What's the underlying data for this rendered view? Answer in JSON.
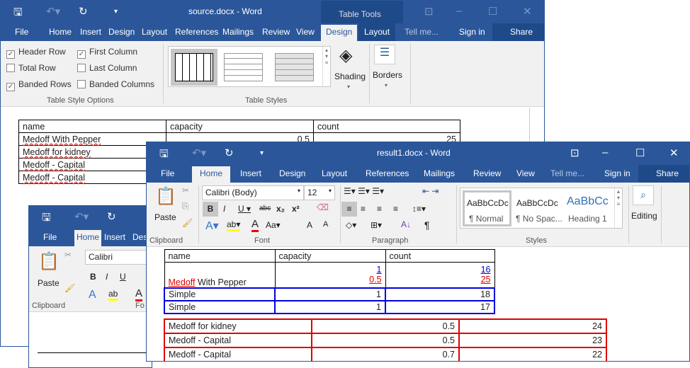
{
  "source_window": {
    "title": "source.docx - Word",
    "context_tab": "Table Tools",
    "tabs": [
      "File",
      "Home",
      "Insert",
      "Design",
      "Layout",
      "References",
      "Mailings",
      "Review",
      "View",
      "Design",
      "Layout"
    ],
    "tell_me": "Tell me...",
    "sign_in": "Sign in",
    "share": "Share",
    "options": [
      {
        "label": "Header Row",
        "checked": true
      },
      {
        "label": "First Column",
        "checked": true
      },
      {
        "label": "Total Row",
        "checked": false
      },
      {
        "label": "Last Column",
        "checked": false
      },
      {
        "label": "Banded Rows",
        "checked": true
      },
      {
        "label": "Banded Columns",
        "checked": false
      }
    ],
    "groups": {
      "options": "Table Style Options",
      "styles": "Table Styles"
    },
    "shading": "Shading",
    "borders": "Borders",
    "table": {
      "headers": [
        "name",
        "capacity",
        "count"
      ],
      "rows": [
        [
          "Medoff With Pepper",
          "0.5",
          "25"
        ],
        [
          "Medoff for kidney",
          "",
          ""
        ],
        [
          "Medoff - Capital",
          "",
          ""
        ],
        [
          "Medoff - Capital",
          "",
          ""
        ]
      ]
    }
  },
  "result_window": {
    "title": "result1.docx - Word",
    "tabs": [
      "File",
      "Home",
      "Insert",
      "Design",
      "Layout",
      "References",
      "Mailings",
      "Review",
      "View"
    ],
    "tell_me": "Tell me...",
    "sign_in": "Sign in",
    "share": "Share",
    "font": "Calibri (Body)",
    "size": "12",
    "paste": "Paste",
    "editing": "Editing",
    "styles": [
      "AaBbCcDc",
      "AaBbCcDc",
      "AaBbCc"
    ],
    "style_names": [
      "¶ Normal",
      "¶ No Spac...",
      "Heading 1"
    ],
    "groups": {
      "clipboard": "Clipboard",
      "font": "Font",
      "paragraph": "Paragraph",
      "styles": "Styles"
    },
    "table": {
      "headers": [
        "name",
        "capacity",
        "count"
      ],
      "first_row": {
        "name_changed": "Medoff",
        "name_rest": " With Pepper",
        "capacity_new": "1",
        "capacity_old": "0.5",
        "count_new": "16",
        "count_old": "25"
      },
      "inserted_rows": [
        [
          "Simple",
          "1",
          "18"
        ],
        [
          "Simple",
          "1",
          "17"
        ]
      ],
      "deleted_rows": [
        [
          "Medoff for kidney",
          "0.5",
          "24"
        ],
        [
          "Medoff - Capital",
          "0.5",
          "23"
        ],
        [
          "Medoff - Capital",
          "0.7",
          "22"
        ]
      ]
    },
    "colors": {
      "inserted": "#0000e0",
      "deleted": "#e00000"
    }
  },
  "third_window": {
    "tabs": [
      "File",
      "Home",
      "Insert",
      "Desi"
    ],
    "font": "Calibri",
    "paste": "Paste",
    "groups": {
      "clipboard": "Clipboard",
      "font": "Fo"
    }
  }
}
